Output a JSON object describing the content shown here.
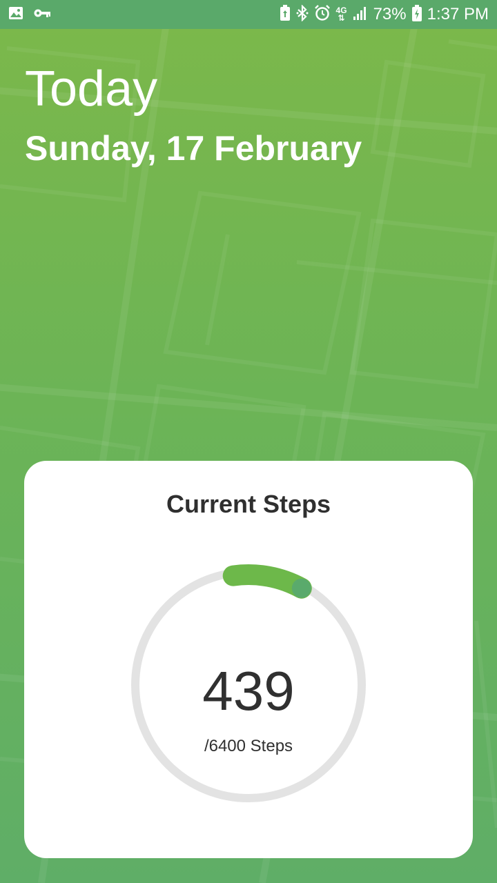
{
  "status_bar": {
    "network": "4G",
    "battery_percent": "73%",
    "time": "1:37 PM",
    "icons": [
      "image-icon",
      "key-icon",
      "battery-saver-icon",
      "bluetooth-icon",
      "alarm-icon",
      "signal-icon",
      "battery-charging-icon"
    ]
  },
  "header": {
    "title": "Today",
    "date": "Sunday, 17 February"
  },
  "steps_card": {
    "title": "Current Steps",
    "current": "439",
    "goal_label": "/6400 Steps",
    "progress_fraction": 0.0686
  },
  "colors": {
    "background": "#6cb456",
    "status_bar": "#5aa96a",
    "ring_track": "#e3e3e3",
    "ring_progress": "#6db84a",
    "ring_knob": "#5aaa6c"
  }
}
